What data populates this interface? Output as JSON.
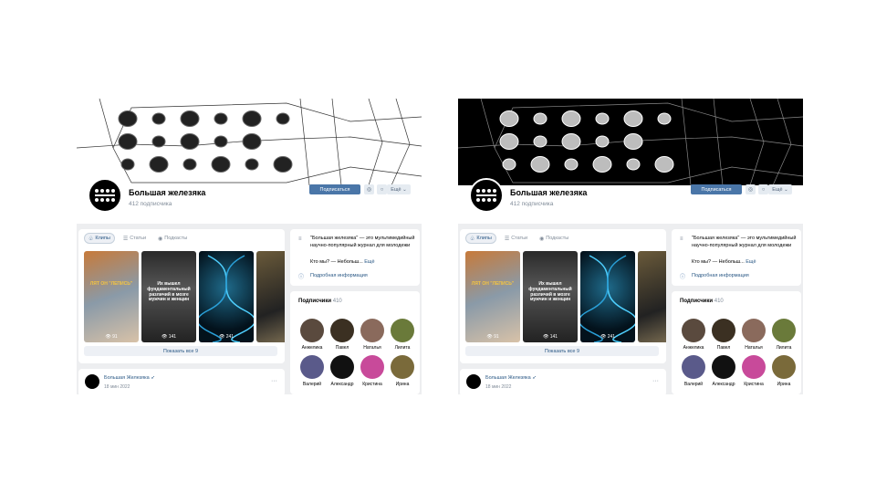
{
  "group": {
    "name": "Большая железяка",
    "subscribers": "412 подписчика"
  },
  "actions": {
    "subscribe": "Подписаться",
    "more": "Ещё"
  },
  "icons": {
    "notify": "bell-icon",
    "message": "message-icon",
    "menu": "menu-icon",
    "info": "info-icon"
  },
  "tabs": [
    {
      "label": "Клипы",
      "icon": "clip-icon",
      "active": true
    },
    {
      "label": "Статьи",
      "icon": "article-icon",
      "active": false
    },
    {
      "label": "Подкасты",
      "icon": "podcast-icon",
      "active": false
    }
  ],
  "clips": [
    {
      "views": "91",
      "caption": "ЛЯТ ОН \"ЛЕПИСЬ\"",
      "caption_color": "#f4c542"
    },
    {
      "views": "141",
      "caption": "Их вышел фундаментальный различий в мозге мужчин и женщин",
      "caption_color": "#ffffff"
    },
    {
      "views": "241",
      "caption": "",
      "caption_color": "#ffffff"
    },
    {
      "views": "",
      "caption": "",
      "caption_color": "#ffffff"
    }
  ],
  "show_all": "Показать все 9",
  "about": {
    "text": "\"Большая железяка\" — это мультимедийный научно-популярный журнал для молодежи",
    "who": "Кто мы? — Небольш...",
    "who_more": "Ещё",
    "info_link": "Подробная информация"
  },
  "members": {
    "title": "Подписчики",
    "count": "410",
    "list": [
      {
        "name": "Анжелика",
        "color": "#5a4a3e"
      },
      {
        "name": "Павел",
        "color": "#3b3022"
      },
      {
        "name": "Наталья",
        "color": "#8a6a5c"
      },
      {
        "name": "Лилита",
        "color": "#6a7a3a"
      },
      {
        "name": "Валерий",
        "color": "#5a5a8a"
      },
      {
        "name": "Александр",
        "color": "#111111"
      },
      {
        "name": "Кристина",
        "color": "#c84a9a"
      },
      {
        "name": "Ирина",
        "color": "#7a6a3a"
      }
    ]
  },
  "post": {
    "author": "Большая Железяка",
    "date": "18 мин 2022"
  },
  "colors": {
    "accent": "#4a76a8",
    "link": "#2a5885",
    "background": "#edeef0"
  }
}
